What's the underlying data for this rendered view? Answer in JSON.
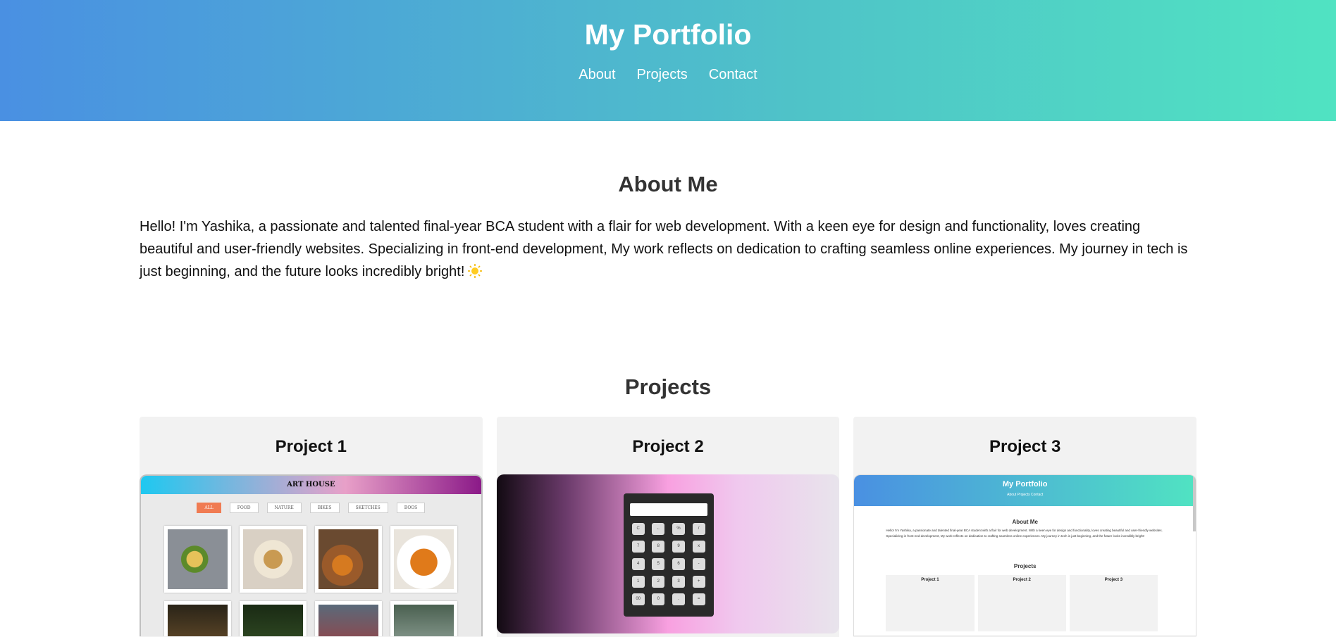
{
  "header": {
    "title": "My Portfolio",
    "nav": [
      "About",
      "Projects",
      "Contact"
    ]
  },
  "about": {
    "heading": "About Me",
    "text": "Hello! I'm Yashika, a passionate and talented final-year BCA student with a flair for web development. With a keen eye for design and functionality, loves creating beautiful and user-friendly websites. Specializing in front-end development, My work reflects on dedication to crafting seamless online experiences. My journey in tech is just beginning, and the future looks incredibly bright!",
    "emoji": "sun-icon"
  },
  "projects": {
    "heading": "Projects",
    "items": [
      {
        "title": "Project 1",
        "preview": {
          "site_title": "ART HOUSE",
          "filters": [
            "ALL",
            "FOOD",
            "NATURE",
            "BIKES",
            "SKETCHES",
            "BOOS"
          ]
        }
      },
      {
        "title": "Project 2",
        "preview": {
          "keys": [
            "C",
            "←",
            "%",
            "/",
            "7",
            "8",
            "9",
            "x",
            "4",
            "5",
            "6",
            "-",
            "1",
            "2",
            "3",
            "+",
            "00",
            "0",
            ".",
            "="
          ]
        }
      },
      {
        "title": "Project 3",
        "preview": {
          "title": "My Portfolio",
          "nav": "About    Projects    Contact",
          "about_heading": "About Me",
          "about_text": "Hello! I'm Yashika, a passionate and talented final-year BCA student with a flair for web development. With a keen eye for design and functionality, loves creating beautiful and user-friendly websites. Specializing in front-end development, My work reflects on dedication to crafting seamless online experiences. My journey in tech is just beginning, and the future looks incredibly bright!",
          "projects_heading": "Projects",
          "cards": [
            "Project 1",
            "Project 2",
            "Project 3"
          ]
        }
      }
    ]
  },
  "colors": {
    "header_gradient_start": "#4a90e2",
    "header_gradient_end": "#50e3c2",
    "card_bg": "#f2f2f2"
  }
}
